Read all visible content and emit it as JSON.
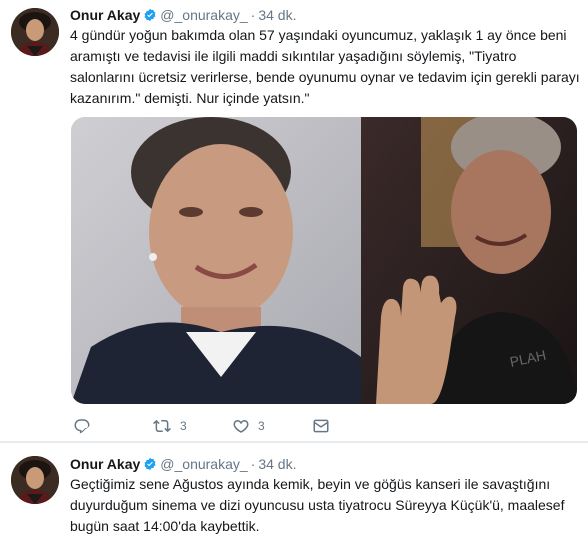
{
  "tweets": [
    {
      "author_name": "Onur Akay",
      "handle": "@_onurakay_",
      "separator": "·",
      "time": "34 dk.",
      "text": "4 gündür yoğun bakımda olan 57 yaşındaki oyuncumuz, yaklaşık 1 ay önce beni aramıştı ve tedavisi ile ilgili maddi sıkıntılar yaşadığını söylemiş, \"Tiyatro salonlarını ücretsiz verirlerse, bende oyunumu oynar ve tedavim için gerekli parayı kazanırım.\" demişti. Nur içinde yatsın.\"",
      "actions": {
        "reply_count": "",
        "retweet_count": "3",
        "like_count": "3"
      },
      "icons": [
        "verified-badge-icon",
        "reply-icon",
        "retweet-icon",
        "like-icon",
        "direct-message-icon"
      ]
    },
    {
      "author_name": "Onur Akay",
      "handle": "@_onurakay_",
      "separator": "·",
      "time": "34 dk.",
      "text": "Geçtiğimiz sene Ağustos ayında kemik, beyin ve göğüs kanseri ile savaştığını duyurduğum sinema ve dizi oyuncusu usta tiyatrocu Süreyya Küçük'ü, maalesef bugün saat 14:00'da kaybettik.",
      "icons": [
        "verified-badge-icon"
      ]
    }
  ],
  "colors": {
    "text": "#14171a",
    "secondary_text": "#657786",
    "verified_blue": "#1da1f2",
    "divider": "#e6ecf0"
  }
}
